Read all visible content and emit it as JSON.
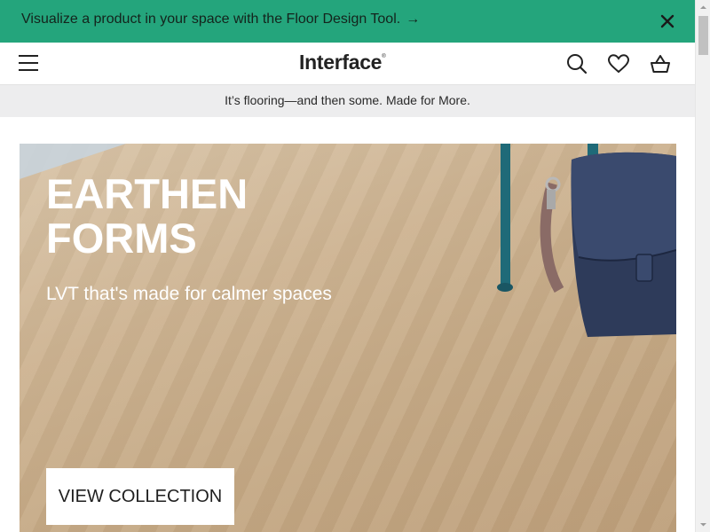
{
  "promo": {
    "text": "Visualize a product in your space with the Floor Design Tool.",
    "arrow": "→",
    "background": "#24a57c"
  },
  "header": {
    "logo": "Interface",
    "logo_mark": "®",
    "icons": [
      "menu-icon",
      "search-icon",
      "heart-icon",
      "basket-icon"
    ]
  },
  "tagline": {
    "text": "It’s flooring—and then some. Made for More."
  },
  "hero": {
    "title_line1": "EARTHEN",
    "title_line2": "FORMS",
    "subtitle": "LVT that's made for calmer spaces",
    "button_label": "VIEW COLLECTION"
  }
}
